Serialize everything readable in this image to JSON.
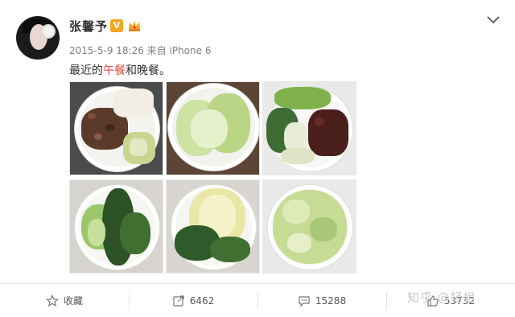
{
  "user": {
    "name": "张馨予",
    "verified_badge": "V",
    "crown_icon": "crown-icon"
  },
  "post": {
    "meta": "2015-5-9 18:26 来自 iPhone 6",
    "text_before": "最近的",
    "text_highlight": "午餐",
    "text_after": "和晚餐。",
    "highlight_color": "#e24a3b"
  },
  "images": [
    {
      "alt": "beef-and-cabbage-plate"
    },
    {
      "alt": "bok-choy-bowl"
    },
    {
      "alt": "mixed-vegetables-and-beef-plate"
    },
    {
      "alt": "bok-choy-plate"
    },
    {
      "alt": "napa-cabbage-bowl"
    },
    {
      "alt": "shredded-cabbage-plate"
    }
  ],
  "actions": {
    "favorite_label": "收藏",
    "repost_count": "6462",
    "comment_count": "15288",
    "like_count": "53732"
  },
  "watermark": "知乎 @轻姐",
  "colors": {
    "text": "#333333",
    "meta": "#808080",
    "badge": "#f5a623"
  }
}
